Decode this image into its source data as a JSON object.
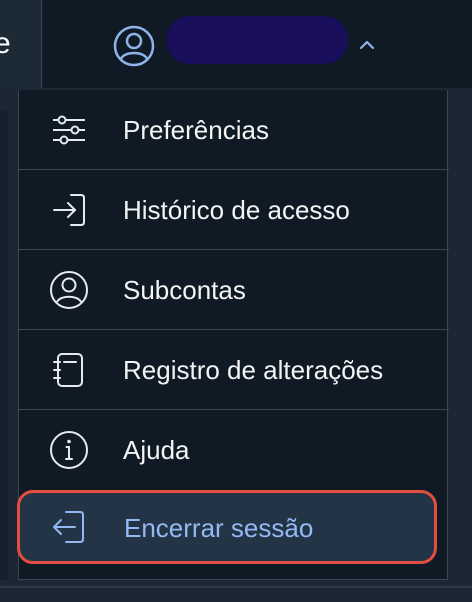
{
  "header": {
    "tab_fragment": "e",
    "account": {
      "avatar_icon": "user-circle-icon",
      "name_redacted": true,
      "name_pill_color": "#1a0f5a",
      "expand_icon": "chevron-up-icon",
      "expanded": true
    }
  },
  "menu": {
    "items": [
      {
        "label": "Preferências",
        "icon": "sliders-icon"
      },
      {
        "label": "Histórico de acesso",
        "icon": "login-arrow-icon"
      },
      {
        "label": "Subcontas",
        "icon": "user-circle-icon"
      },
      {
        "label": "Registro de alterações",
        "icon": "notebook-icon"
      },
      {
        "label": "Ajuda",
        "icon": "info-icon"
      },
      {
        "label": "Encerrar sessão",
        "icon": "logout-arrow-icon",
        "highlighted": true
      }
    ]
  },
  "colors": {
    "background": "#0f1a24",
    "text": "#f2f4f6",
    "logout_text": "#93b8f2",
    "logout_bg": "#243447",
    "highlight_border": "#e24e3f",
    "divider": "#3a4753",
    "icon": "#e6eaee",
    "avatar_icon": "#8fb4ea"
  }
}
